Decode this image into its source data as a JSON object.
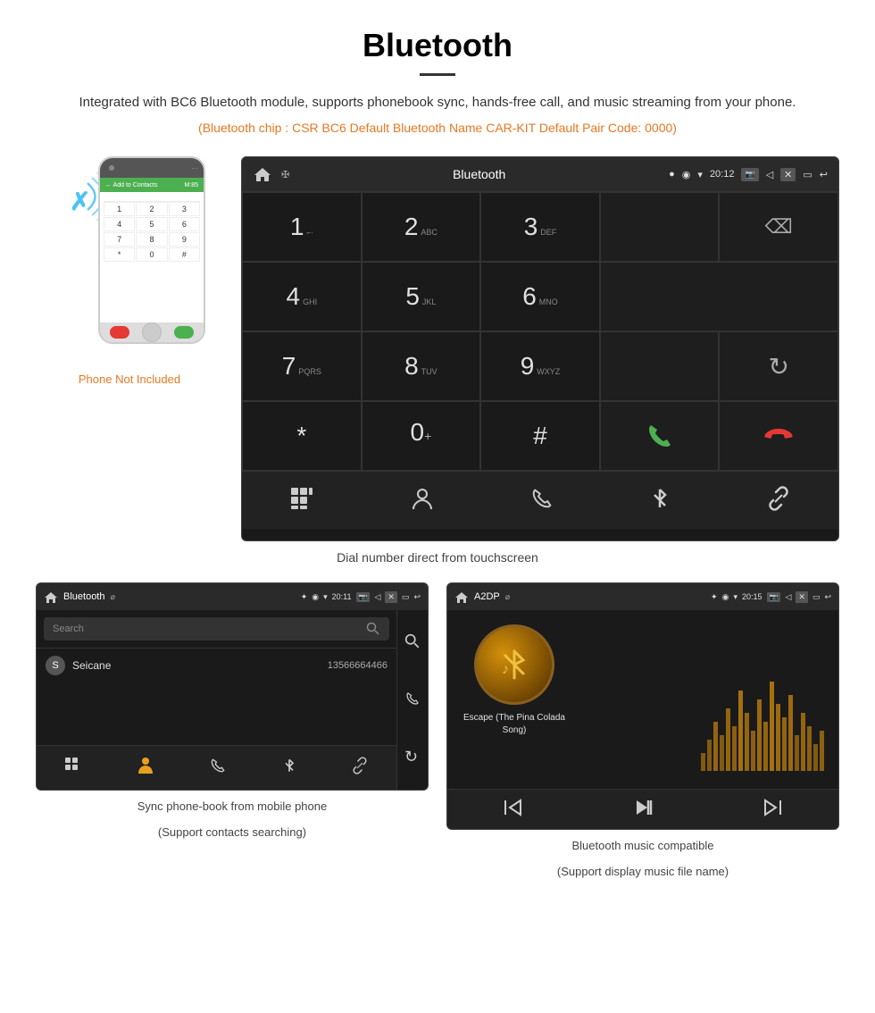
{
  "page": {
    "title": "Bluetooth",
    "description": "Integrated with BC6 Bluetooth module, supports phonebook sync, hands-free call, and music streaming from your phone.",
    "specs": "(Bluetooth chip : CSR BC6    Default Bluetooth Name CAR-KIT     Default Pair Code: 0000)",
    "dial_caption": "Dial number direct from touchscreen",
    "phonebook_caption_line1": "Sync phone-book from mobile phone",
    "phonebook_caption_line2": "(Support contacts searching)",
    "music_caption_line1": "Bluetooth music compatible",
    "music_caption_line2": "(Support display music file name)"
  },
  "topbar_dialpad": {
    "title": "Bluetooth",
    "time": "20:12"
  },
  "dialpad": {
    "keys": [
      {
        "number": "1",
        "letters": "⌐·"
      },
      {
        "number": "2",
        "letters": "ABC"
      },
      {
        "number": "3",
        "letters": "DEF"
      },
      {
        "number": "4",
        "letters": "GHI"
      },
      {
        "number": "5",
        "letters": "JKL"
      },
      {
        "number": "6",
        "letters": "MNO"
      },
      {
        "number": "7",
        "letters": "PQRS"
      },
      {
        "number": "8",
        "letters": "TUV"
      },
      {
        "number": "9",
        "letters": "WXYZ"
      },
      {
        "number": "*",
        "letters": ""
      },
      {
        "number": "0",
        "letters": "+"
      },
      {
        "number": "#",
        "letters": ""
      }
    ]
  },
  "phone": {
    "not_included_label": "Phone Not Included",
    "contact_name": "Seicane",
    "contact_number": "13566664466",
    "contact_letter": "S",
    "search_placeholder": "Search"
  },
  "phonebook": {
    "title": "Bluetooth",
    "time": "20:11"
  },
  "music": {
    "title": "A2DP",
    "time": "20:15",
    "song_title": "Escape (The Pina Colada Song)"
  },
  "icons": {
    "home": "⌂",
    "usb": "⌀",
    "bluetooth": "✦",
    "wifi": "▾",
    "location": "◉",
    "camera": "⬛",
    "volume": "◁",
    "close_x": "✕",
    "back": "↩",
    "delete_back": "⌫",
    "refresh": "↻",
    "call_green": "📞",
    "call_red": "📵",
    "grid": "⊞",
    "person": "👤",
    "phone_icon": "📱",
    "asterisk": "✱",
    "link": "🔗",
    "prev": "⏮",
    "play_pause": "⏯",
    "next": "⏭",
    "search": "🔍"
  }
}
